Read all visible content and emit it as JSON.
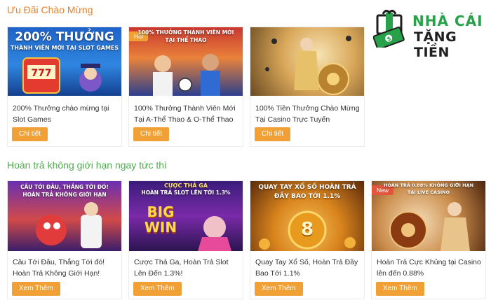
{
  "sections": {
    "welcome_title": "Ưu Đãi Chào Mừng",
    "refund_title": "Hoàn trả không giới hạn ngay tức thì"
  },
  "brand": {
    "line1": "NHÀ CÁI",
    "line2": "TẶNG TIỀN",
    "color_green": "#27a24a",
    "color_dark": "#1f1f1f"
  },
  "welcome_cards": [
    {
      "banner_line1": "200% THƯỞNG",
      "banner_line2": "THÀNH VIÊN MỚI TẠI SLOT GAMES",
      "badge": "",
      "desc": "200% Thưởng chào mừng tại Slot Games",
      "button": "Chi tiết"
    },
    {
      "banner_line1": "100% THƯỞNG THÀNH VIÊN MỚI",
      "banner_line2": "TẠI THỂ THAO",
      "badge": "Hot",
      "desc": "100% Thưởng Thành Viên Mới Tại A-Thể Thao & O-Thể Thao",
      "button": "Chi tiết"
    },
    {
      "banner_line1": "",
      "banner_line2": "",
      "badge": "",
      "desc": "100% Tiền Thưởng Chào Mừng Tại Casino Trực Tuyến",
      "button": "Chi tiết"
    }
  ],
  "refund_cards": [
    {
      "banner_line1": "CÂU TỚI ĐÂU, THẮNG TỚI ĐÓ!",
      "banner_line2": "HOÀN TRẢ KHÔNG GIỚI HẠN",
      "badge": "",
      "desc": "Câu Tới Đâu, Thắng Tới đó! Hoàn Trả Không Giới Hạn!",
      "button": "Xem Thêm"
    },
    {
      "banner_line1": "CƯỢC THẢ GA",
      "banner_line2": "HOÀN TRẢ SLOT LÊN TỚI 1.3%",
      "banner_big1": "BIG",
      "banner_big2": "WIN",
      "badge": "",
      "desc": "Cược Thả Ga, Hoàn Trả Slot Lên Đến 1.3%!",
      "button": "Xem Thêm"
    },
    {
      "banner_line1": "QUAY TAY XỔ SỐ HOÀN TRẢ",
      "banner_line2": "ĐẦY BAO TỚI 1.1%",
      "banner_big1": "8",
      "badge": "",
      "desc": "Quay Tay Xổ Số, Hoàn Trả Đầy Bao Tới 1.1%",
      "button": "Xem Thêm"
    },
    {
      "banner_line1": "HOÀN TRẢ 0.88% KHÔNG GIỚI HẠN",
      "banner_line2": "TẠI LIVE CASINO",
      "badge": "New",
      "desc": "Hoàn Trả Cực Khủng tại Casino lên đến 0.88%",
      "button": "Xem Thêm"
    }
  ],
  "colors": {
    "title_orange": "#e8812a",
    "title_green": "#4cae4c",
    "button": "#f0a035"
  }
}
